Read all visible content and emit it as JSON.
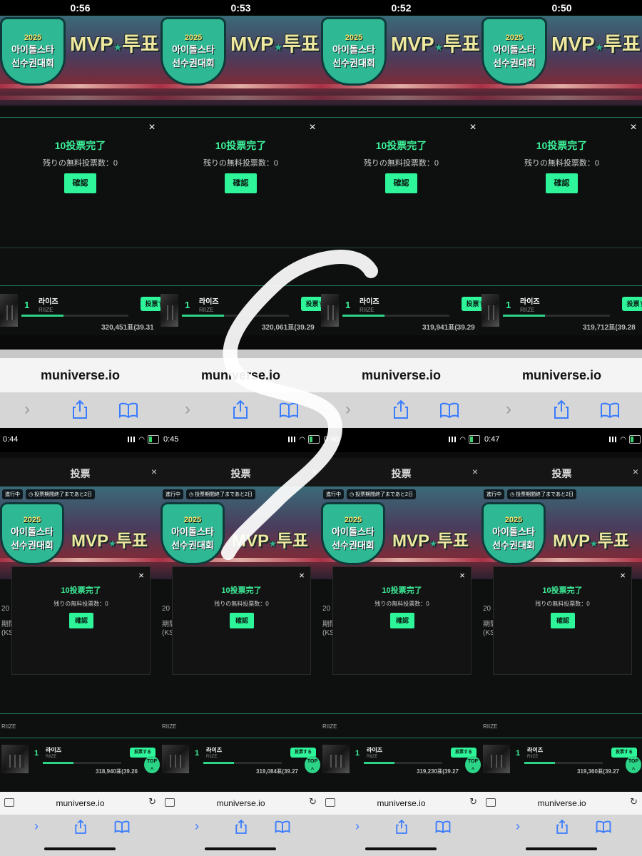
{
  "top_row": {
    "panels": [
      {
        "countdown": "0:56",
        "votes": "320,451표(39.31"
      },
      {
        "countdown": "0:53",
        "votes": "320,061표(39.29"
      },
      {
        "countdown": "0:52",
        "votes": "319,941표(39.29"
      },
      {
        "countdown": "0:50",
        "votes": "319,712표(39.28"
      }
    ]
  },
  "bottom_row": {
    "panels": [
      {
        "time": "0:44",
        "votes": "318,940표(39.26"
      },
      {
        "time": "0:45",
        "votes": "319,084표(39.27"
      },
      {
        "time": "0:46",
        "votes": "319,230표(39.27"
      },
      {
        "time": "0:47",
        "votes": "319,360표(39.27"
      }
    ],
    "header_title": "投票",
    "status_pill": "進行中",
    "period_pill": "投票期間終了まであと2日",
    "side_label_1": "20",
    "side_label_2": "期間",
    "side_label_3": "(KS",
    "riize_small": "RIIZE",
    "vote_button": "投票する",
    "top_button": "TOP"
  },
  "banner": {
    "logo_line1": "아이돌스타",
    "logo_line2": "선수권대회",
    "year": "2025",
    "mvp": "MVP",
    "vote_word": "투표"
  },
  "modal": {
    "title": "10投票完了",
    "subtitle": "残りの無料投票数：0",
    "confirm": "確認",
    "close": "×"
  },
  "ranking": {
    "rank": "1",
    "artist_kr": "라이즈",
    "artist_en": "RIIZE",
    "vote_button": "投票す",
    "progress": 0.39
  },
  "browser": {
    "url": "muniverse.io",
    "forward_icon": "chevron-right-icon",
    "share_icon": "share-icon",
    "bookmarks_icon": "book-icon"
  },
  "colors": {
    "accent": "#2ef59a",
    "title_green": "#3cf29a",
    "safari_blue": "#3a7cff"
  }
}
